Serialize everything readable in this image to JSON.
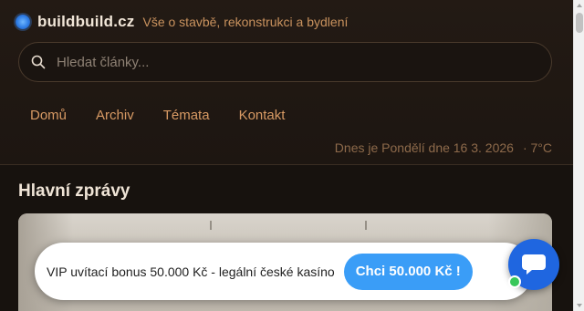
{
  "header": {
    "brand": "buildbuild.cz",
    "tagline": "Vše o stavbě, rekonstrukci a bydlení",
    "logo_icon": "blue-dot-logo"
  },
  "search": {
    "placeholder": "Hledat články...",
    "value": "",
    "icon": "search-icon"
  },
  "nav": {
    "items": [
      {
        "label": "Domů"
      },
      {
        "label": "Archiv"
      },
      {
        "label": "Témata"
      },
      {
        "label": "Kontakt"
      }
    ]
  },
  "dateline": {
    "date_text": "Dnes je Pondělí dne 16 3. 2026",
    "weather_text": "· 7°C"
  },
  "main": {
    "section_title": "Hlavní zprávy"
  },
  "promo": {
    "text": "VIP uvítací bonus 50.000 Kč - legální české kasíno",
    "button_label": "Chci 50.000 Kč !",
    "close_glyph": "×"
  },
  "colors": {
    "accent": "#d89a64",
    "button": "#3a9df7",
    "chat": "#1f66e0",
    "online": "#38c759"
  }
}
